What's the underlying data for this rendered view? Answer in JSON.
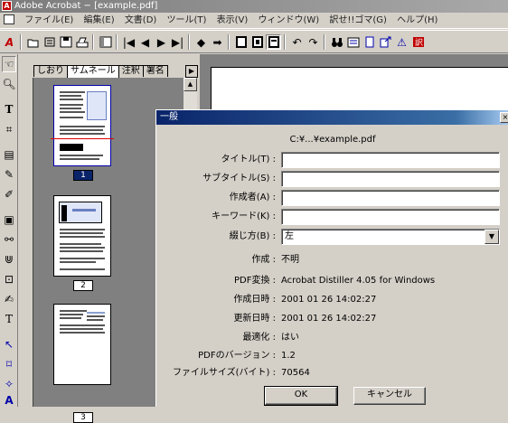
{
  "window": {
    "title": "Adobe Acrobat − [example.pdf]"
  },
  "menu": [
    "ファイル(E)",
    "編集(E)",
    "文書(D)",
    "ツール(T)",
    "表示(V)",
    "ウィンドウ(W)",
    "訳せ!!ゴマ(G)",
    "ヘルプ(H)"
  ],
  "toolbar_icons": [
    "acrobat-logo",
    "open",
    "print-setup",
    "save",
    "print",
    "show-hide-nav",
    "first-page",
    "prev-page",
    "next-page",
    "last-page",
    "go-back",
    "go-forward",
    "actual-size",
    "fit-page",
    "fit-width",
    "rotate-left",
    "rotate-right",
    "find",
    "page-layout",
    "single-page",
    "web-link",
    "warning",
    "translate"
  ],
  "nav": {
    "tabs": [
      "しおり",
      "サムネール",
      "注釈",
      "署名"
    ],
    "pages": [
      "1",
      "2",
      "3"
    ]
  },
  "dialog": {
    "title": "一般",
    "path": "C:¥...¥example.pdf",
    "fields": [
      {
        "label": "タイトル(T) :",
        "value": ""
      },
      {
        "label": "サブタイトル(S) :",
        "value": ""
      },
      {
        "label": "作成者(A) :",
        "value": ""
      },
      {
        "label": "キーワード(K) :",
        "value": ""
      }
    ],
    "binding": {
      "label": "綴じ方(B) :",
      "value": "左"
    },
    "info": [
      {
        "label": "作成 :",
        "value": "不明"
      },
      {
        "label": "PDF変換 :",
        "value": "Acrobat Distiller 4.05 for Windows"
      },
      {
        "label": "作成日時 :",
        "value": "2001 01 26 14:02:27"
      },
      {
        "label": "更新日時 :",
        "value": "2001 01 26 14:02:27"
      },
      {
        "label": "最適化 :",
        "value": "はい"
      },
      {
        "label": "PDFのバージョン :",
        "value": "1.2"
      },
      {
        "label": "ファイルサイズ(バイト) :",
        "value": "70564"
      }
    ],
    "ok": "OK",
    "cancel": "キャンセル"
  }
}
